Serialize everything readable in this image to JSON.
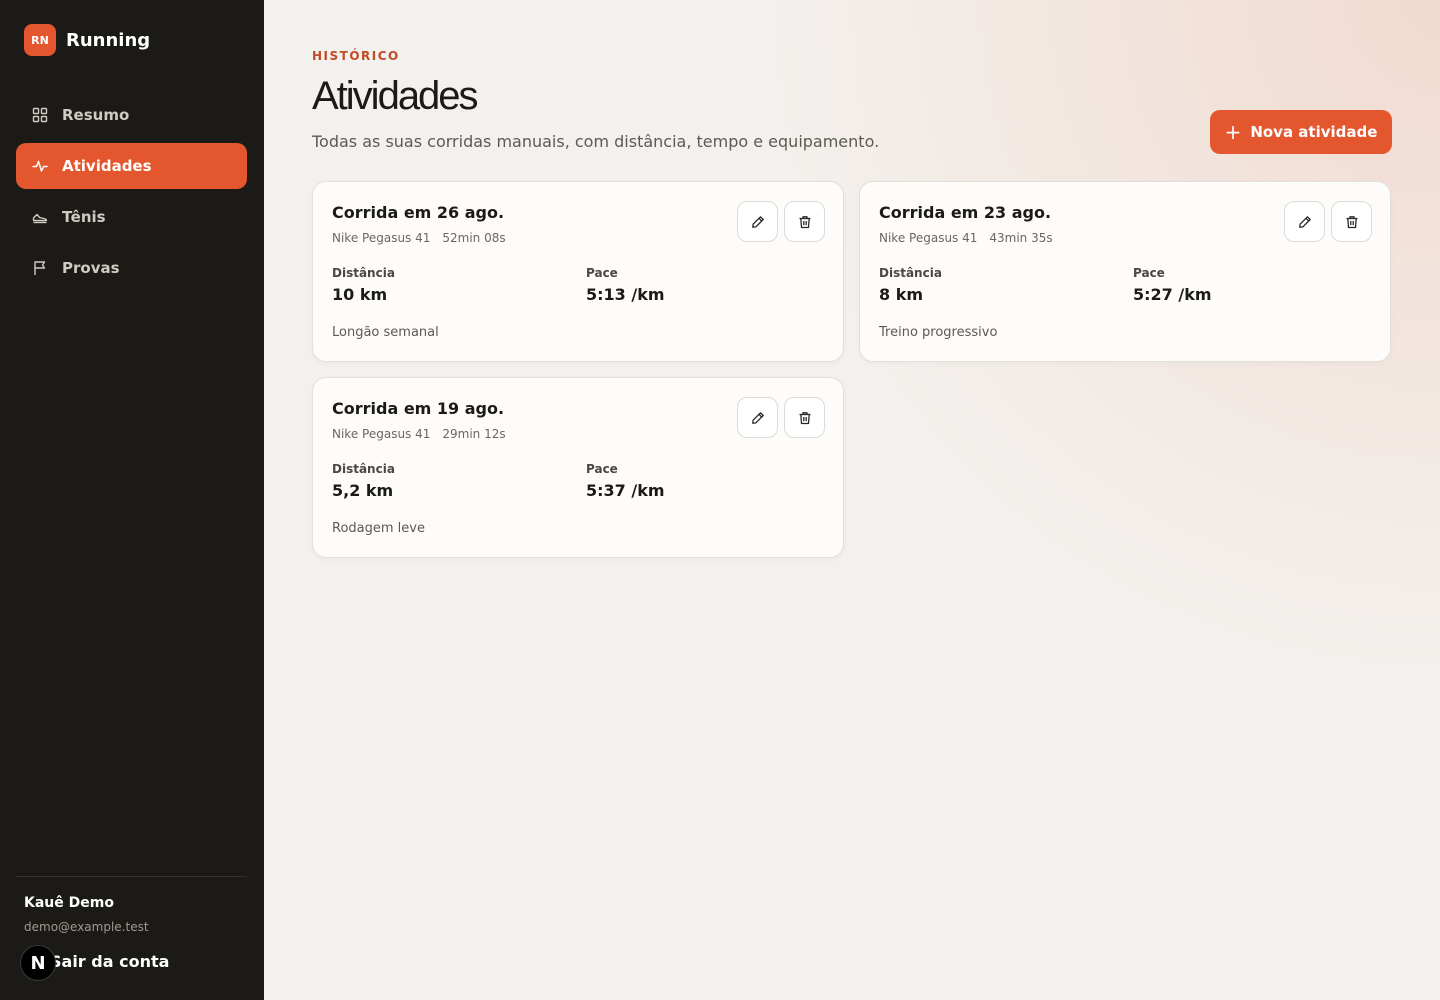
{
  "brand": {
    "logo_text": "RN",
    "name": "Running",
    "accent": "#e4572e"
  },
  "sidebar": {
    "items": [
      {
        "label": "Resumo",
        "icon": "grid-icon",
        "active": false
      },
      {
        "label": "Atividades",
        "icon": "activity-icon",
        "active": true
      },
      {
        "label": "Tênis",
        "icon": "shoe-icon",
        "active": false
      },
      {
        "label": "Provas",
        "icon": "flag-icon",
        "active": false
      }
    ],
    "user": {
      "name": "Kauê Demo",
      "email": "demo@example.test"
    },
    "logout_label": "Sair da conta",
    "badge": "N"
  },
  "header": {
    "eyebrow": "HISTÓRICO",
    "title": "Atividades",
    "subtitle": "Todas as suas corridas manuais, com distância, tempo e equipamento.",
    "new_button": "Nova atividade"
  },
  "labels": {
    "distance": "Distância",
    "pace": "Pace"
  },
  "activities": [
    {
      "title": "Corrida em 26 ago.",
      "shoe": "Nike Pegasus 41",
      "duration": "52min 08s",
      "distance": "10 km",
      "pace": "5:13 /km",
      "note": "Longão semanal"
    },
    {
      "title": "Corrida em 23 ago.",
      "shoe": "Nike Pegasus 41",
      "duration": "43min 35s",
      "distance": "8 km",
      "pace": "5:27 /km",
      "note": "Treino progressivo"
    },
    {
      "title": "Corrida em 19 ago.",
      "shoe": "Nike Pegasus 41",
      "duration": "29min 12s",
      "distance": "5,2 km",
      "pace": "5:37 /km",
      "note": "Rodagem leve"
    }
  ]
}
